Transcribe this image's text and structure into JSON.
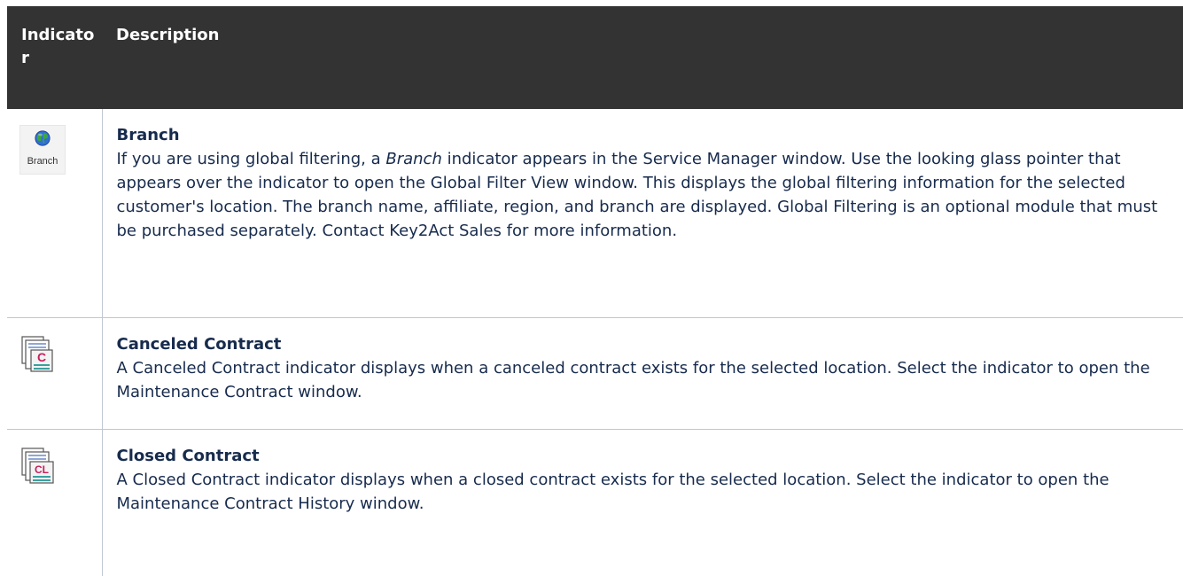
{
  "table": {
    "headers": {
      "indicator": "Indicator",
      "description": "Description"
    },
    "rows": [
      {
        "icon": "branch-globe-icon",
        "icon_label": "Branch",
        "title": "Branch",
        "body_before": "If you are using global filtering, a ",
        "body_em": "Branch",
        "body_after": " indicator appears in the Service Manager window. Use the looking glass pointer that appears over the indicator to open the Global Filter View window. This displays the global filtering information for the selected customer's location. The branch name, affiliate, region, and branch are displayed. Global Filtering is an optional module that must be purchased separately. Contact Key2Act Sales for more information."
      },
      {
        "icon": "canceled-contract-icon",
        "icon_text": "C",
        "title": "Canceled Contract",
        "body": "A Canceled Contract indicator displays when a canceled contract exists for the selected location. Select the indicator to open the Maintenance Contract window."
      },
      {
        "icon": "closed-contract-icon",
        "icon_text": "CL",
        "title": "Closed Contract",
        "body": "A Closed Contract indicator displays when a closed contract exists for the selected location. Select the indicator to open the Maintenance Contract History window."
      }
    ]
  },
  "colors": {
    "header_background": "#333333",
    "header_text": "#ffffff",
    "body_text": "#172b4d",
    "border": "#c1c7d0"
  }
}
